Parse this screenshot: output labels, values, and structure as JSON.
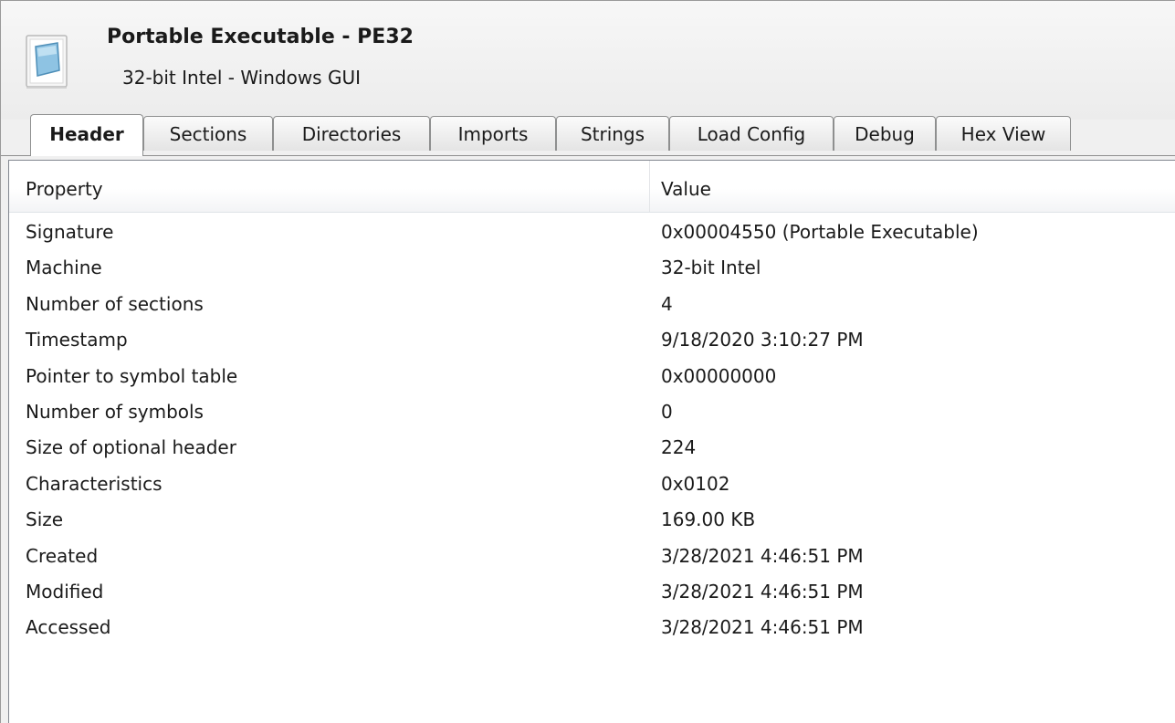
{
  "file": {
    "icon": "document-file-icon",
    "title": "Portable Executable - PE32",
    "subtitle": "32-bit Intel - Windows GUI"
  },
  "tabs": [
    {
      "label": "Header",
      "active": true
    },
    {
      "label": "Sections",
      "active": false
    },
    {
      "label": "Directories",
      "active": false
    },
    {
      "label": "Imports",
      "active": false
    },
    {
      "label": "Strings",
      "active": false
    },
    {
      "label": "Load Config",
      "active": false
    },
    {
      "label": "Debug",
      "active": false
    },
    {
      "label": "Hex View",
      "active": false
    }
  ],
  "table": {
    "columns": [
      "Property",
      "Value"
    ],
    "rows": [
      {
        "property": "Signature",
        "value": "0x00004550 (Portable Executable)"
      },
      {
        "property": "Machine",
        "value": "32-bit Intel"
      },
      {
        "property": "Number of sections",
        "value": "4"
      },
      {
        "property": "Timestamp",
        "value": "9/18/2020 3:10:27 PM"
      },
      {
        "property": "Pointer to symbol table",
        "value": "0x00000000"
      },
      {
        "property": "Number of symbols",
        "value": "0"
      },
      {
        "property": "Size of optional header",
        "value": "224"
      },
      {
        "property": "Characteristics",
        "value": "0x0102"
      },
      {
        "property": "Size",
        "value": "169.00 KB"
      },
      {
        "property": "Created",
        "value": "3/28/2021 4:46:51 PM"
      },
      {
        "property": "Modified",
        "value": "3/28/2021 4:46:51 PM"
      },
      {
        "property": "Accessed",
        "value": "3/28/2021 4:46:51 PM"
      }
    ]
  },
  "colors": {
    "tab_border": "#8e8f8f",
    "panel_border": "#828790",
    "window_bg": "#f0f0f0"
  }
}
